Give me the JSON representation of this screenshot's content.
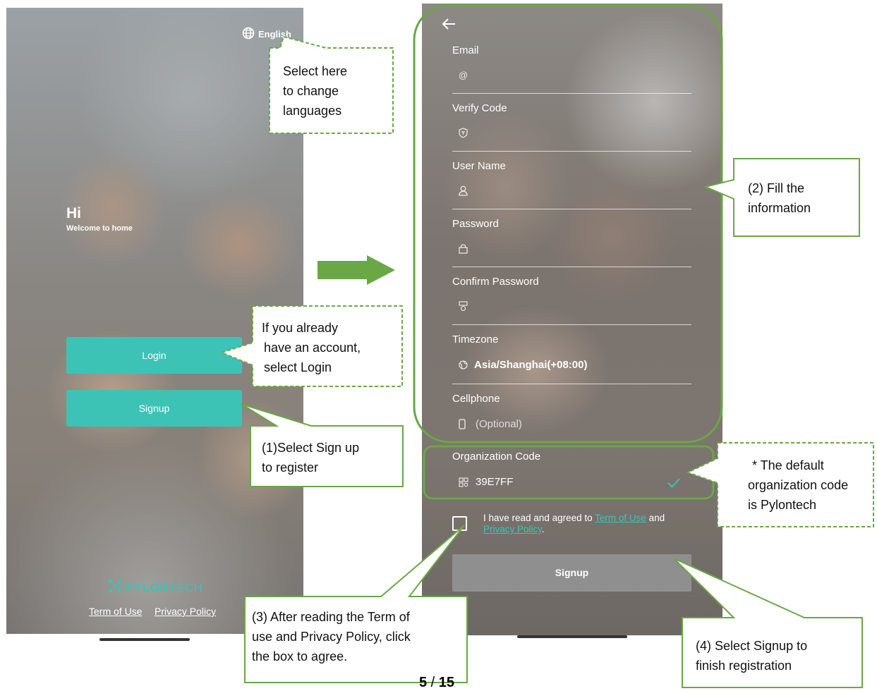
{
  "left_phone": {
    "language_label": "English",
    "greeting": "Hi",
    "welcome": "Welcome to home",
    "login_label": "Login",
    "signup_label": "Signup",
    "logo_text_bold": "PYLON",
    "logo_text_light": "TECH",
    "term_of_use": "Term of Use",
    "privacy_policy": "Privacy Policy"
  },
  "right_phone": {
    "fields": {
      "email": {
        "label": "Email"
      },
      "verify_code": {
        "label": "Verify Code"
      },
      "user_name": {
        "label": "User Name"
      },
      "password": {
        "label": "Password"
      },
      "confirm_password": {
        "label": "Confirm Password"
      },
      "timezone": {
        "label": "Timezone",
        "value": "Asia/Shanghai(+08:00)"
      },
      "cellphone": {
        "label": "Cellphone",
        "placeholder": "(Optional)"
      },
      "organization_code": {
        "label": "Organization Code",
        "value": "39E7FF"
      }
    },
    "agree_prefix": "I have read and agreed to ",
    "agree_term": "Term of Use",
    "agree_and": " and",
    "agree_privacy": "Privacy Policy",
    "agree_suffix": ".",
    "signup_label": "Signup"
  },
  "callouts": {
    "languages": [
      "Select here",
      "to change",
      "languages"
    ],
    "login": [
      "If you already",
      "have an account,",
      "select Login"
    ],
    "signup": [
      "(1)Select Sign up",
      "to register"
    ],
    "fill": [
      "(2) Fill the",
      "information"
    ],
    "org_code": [
      "* The default",
      "organization code",
      "is Pylontech"
    ],
    "agree": [
      "(3) After reading the Term of",
      "use and Privacy Policy, click",
      "the box to agree."
    ],
    "finish": [
      "(4) Select Signup to",
      "finish registration"
    ]
  },
  "page": {
    "current": "5",
    "separator": " / ",
    "total": "15"
  },
  "colors": {
    "teal": "#3cc3b6",
    "callout_green": "#6aa745",
    "signup_disabled": "#8f8f8f"
  }
}
